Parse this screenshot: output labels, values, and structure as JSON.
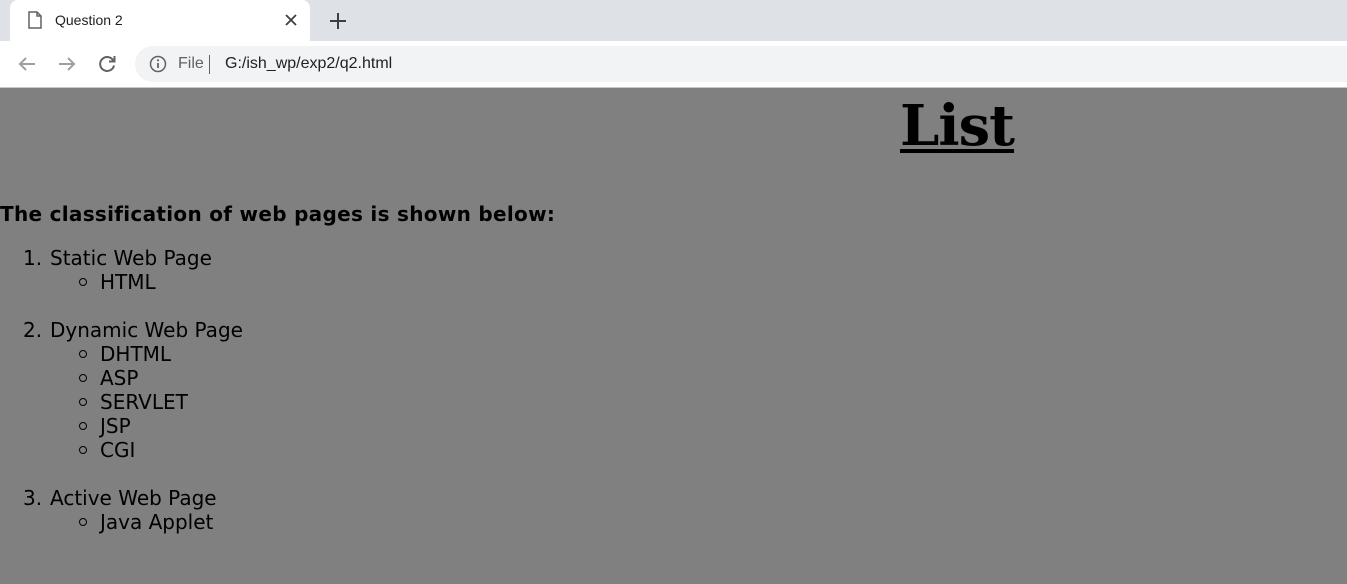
{
  "browser": {
    "tab_title": "Question 2",
    "address_scheme": "File",
    "address_url": "G:/ish_wp/exp2/q2.html"
  },
  "page": {
    "heading": "List",
    "intro": "The classification of web pages is shown below:",
    "list": [
      {
        "number": "1.",
        "label": "Static Web Page",
        "children": [
          "HTML"
        ]
      },
      {
        "number": "2.",
        "label": "Dynamic Web Page",
        "children": [
          "DHTML",
          "ASP",
          "SERVLET",
          "JSP",
          "CGI"
        ]
      },
      {
        "number": "3.",
        "label": "Active Web Page",
        "children": [
          "Java Applet"
        ]
      }
    ],
    "background_color": "#808080"
  },
  "icons": {
    "tab": "document-icon",
    "close": "close-icon",
    "new_tab": "plus-icon",
    "back": "back-arrow-icon",
    "forward": "forward-arrow-icon",
    "reload": "reload-icon",
    "site_info": "info-icon"
  }
}
